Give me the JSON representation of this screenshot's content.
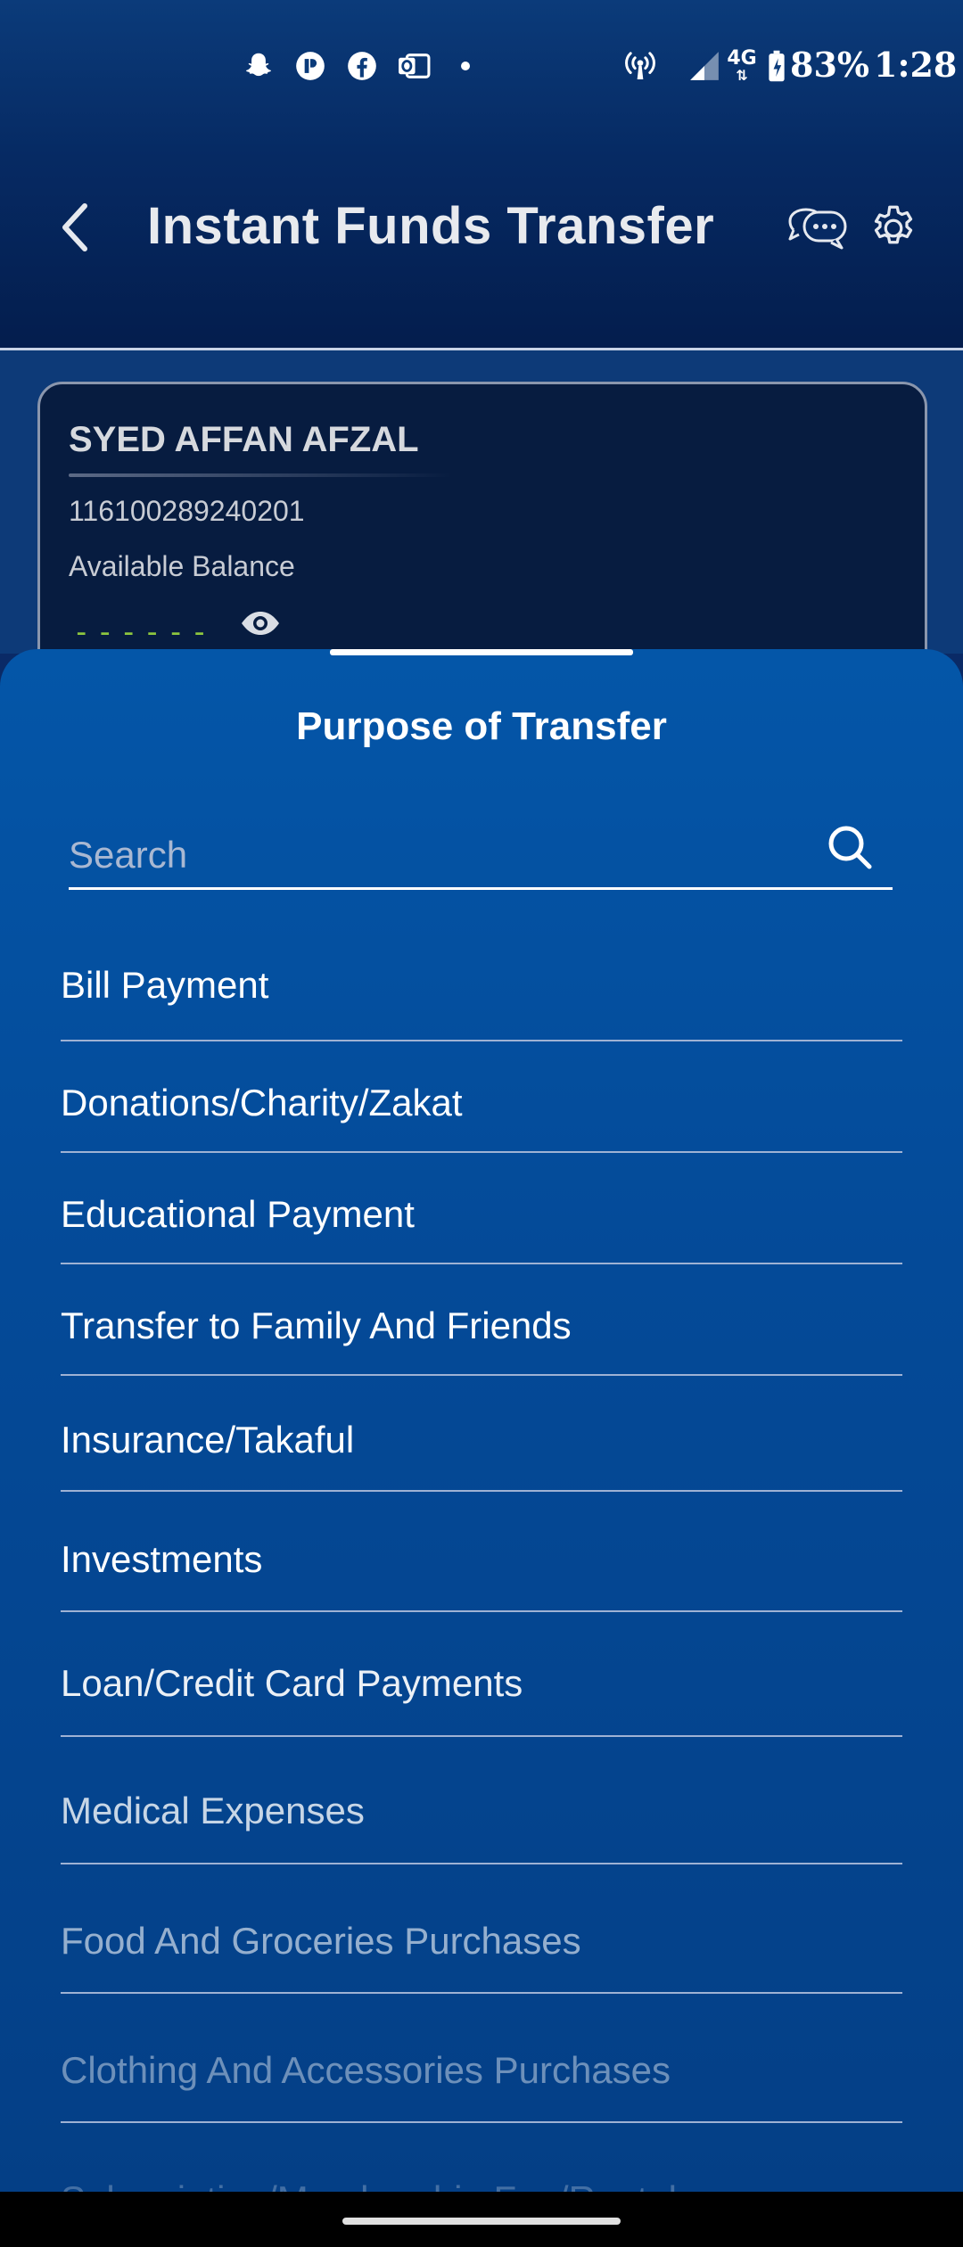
{
  "status_bar": {
    "battery": "83%",
    "time": "1:28",
    "network": "4G"
  },
  "header": {
    "title": "Instant Funds Transfer"
  },
  "account": {
    "name": "SYED AFFAN AFZAL",
    "number": "116100289240201",
    "balance_label": "Available Balance",
    "balance_masked": "------"
  },
  "sheet": {
    "title": "Purpose of Transfer",
    "search_placeholder": "Search",
    "items": [
      {
        "label": "Bill Payment"
      },
      {
        "label": "Donations/Charity/Zakat"
      },
      {
        "label": "Educational Payment"
      },
      {
        "label": "Transfer to Family And Friends"
      },
      {
        "label": "Insurance/Takaful"
      },
      {
        "label": "Investments"
      },
      {
        "label": "Loan/Credit Card Payments"
      },
      {
        "label": "Medical Expenses"
      },
      {
        "label": "Food And Groceries Purchases"
      },
      {
        "label": "Clothing And Accessories Purchases"
      },
      {
        "label": "Subscription/Membership Fee/Rental"
      }
    ]
  },
  "colors": {
    "accent_green": "#8dc63f",
    "sheet_blue": "#0456a8",
    "header_navy": "#041d4d"
  }
}
